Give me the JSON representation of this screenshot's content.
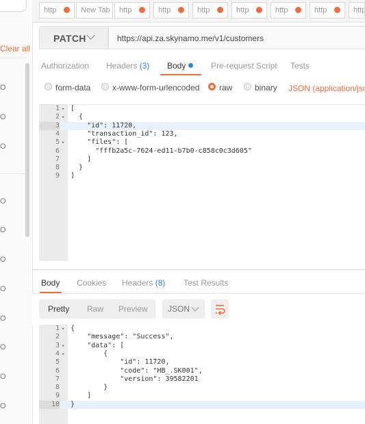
{
  "sidebar": {
    "clear_all": "Clear all",
    "history_items": [
      "O",
      "O",
      "O",
      "O",
      "O",
      "O",
      "O",
      "O",
      "O",
      "O",
      "O"
    ]
  },
  "tabs": [
    "http",
    "New Tab",
    "http",
    "http",
    "http",
    "http",
    "http",
    "http",
    "http"
  ],
  "request": {
    "method": "PATCH",
    "url": "https://api.za.skynamo.me/v1/customers"
  },
  "request_tabs": {
    "authorization": "Authorization",
    "headers": "Headers",
    "headers_count": "(3)",
    "body": "Body",
    "pre_request": "Pre-request Script",
    "tests": "Tests"
  },
  "body_types": {
    "form_data": "form-data",
    "urlencoded": "x-www-form-urlencoded",
    "raw": "raw",
    "binary": "binary",
    "content_type": "JSON (application/json)"
  },
  "request_body": [
    {
      "n": "1",
      "fold": "▾",
      "code": "["
    },
    {
      "n": "2",
      "fold": "▾",
      "code": "  {"
    },
    {
      "n": "3",
      "fold": "",
      "code": "    \"id\": 11720,"
    },
    {
      "n": "4",
      "fold": "",
      "code": "    \"transaction_id\": 123,"
    },
    {
      "n": "5",
      "fold": "▾",
      "code": "    \"files\": ["
    },
    {
      "n": "6",
      "fold": "",
      "code": "      \"fffb2a5c-7624-ed11-b7b0-c858c0c3d605\""
    },
    {
      "n": "7",
      "fold": "",
      "code": "    ]"
    },
    {
      "n": "8",
      "fold": "",
      "code": "  }"
    },
    {
      "n": "9",
      "fold": "",
      "code": "]"
    }
  ],
  "response_tabs": {
    "body": "Body",
    "cookies": "Cookies",
    "headers": "Headers",
    "headers_count": "(8)",
    "test_results": "Test Results"
  },
  "response_view": {
    "pretty": "Pretty",
    "raw": "Raw",
    "preview": "Preview",
    "format": "JSON"
  },
  "response_body": [
    {
      "n": "1",
      "fold": "▾",
      "code": "{"
    },
    {
      "n": "2",
      "fold": "",
      "code": "    \"message\": \"Success\","
    },
    {
      "n": "3",
      "fold": "▾",
      "code": "    \"data\": ["
    },
    {
      "n": "4",
      "fold": "▾",
      "code": "        {"
    },
    {
      "n": "5",
      "fold": "",
      "code": "            \"id\": 11720,"
    },
    {
      "n": "6",
      "fold": "",
      "code": "            \"code\": \"HB_.SK001\","
    },
    {
      "n": "7",
      "fold": "",
      "code": "            \"version\": 39582201"
    },
    {
      "n": "8",
      "fold": "",
      "code": "        }"
    },
    {
      "n": "9",
      "fold": "",
      "code": "    ]"
    },
    {
      "n": "10",
      "fold": "",
      "code": "}"
    }
  ],
  "colors": {
    "accent": "#f26b3a",
    "count": "#2e86de"
  }
}
